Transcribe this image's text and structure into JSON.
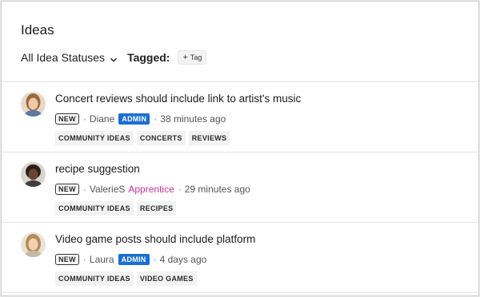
{
  "header": {
    "title": "Ideas",
    "status_filter": "All Idea Statuses",
    "tagged_label": "Tagged:",
    "add_tag_label": "Tag"
  },
  "colors": {
    "admin_badge": "#1a6fd1",
    "apprentice_role": "#c8329a",
    "tag_bg": "#f2f2f2"
  },
  "ideas": [
    {
      "title": "Concert reviews should include link to artist's music",
      "badge": "NEW",
      "author": "Diane",
      "role": "ADMIN",
      "time": "38 minutes ago",
      "tags": [
        "COMMUNITY IDEAS",
        "CONCERTS",
        "REVIEWS"
      ]
    },
    {
      "title": "recipe suggestion",
      "badge": "NEW",
      "author": "ValerieS",
      "role": "Apprentice",
      "time": "29 minutes ago",
      "tags": [
        "COMMUNITY IDEAS",
        "RECIPES"
      ]
    },
    {
      "title": "Video game posts should include platform",
      "badge": "NEW",
      "author": "Laura",
      "role": "ADMIN",
      "time": "4 days ago",
      "tags": [
        "COMMUNITY IDEAS",
        "VIDEO GAMES"
      ]
    }
  ]
}
